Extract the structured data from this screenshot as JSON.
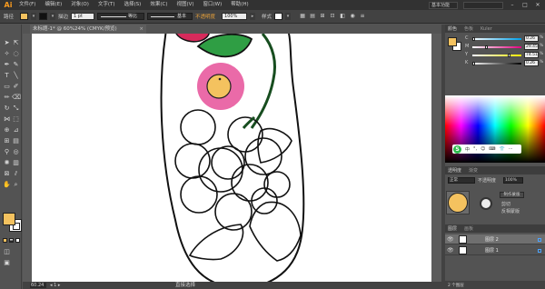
{
  "app": {
    "logo": "Ai"
  },
  "menu": [
    "文件(F)",
    "编辑(E)",
    "对象(O)",
    "文字(T)",
    "选择(S)",
    "效果(C)",
    "视图(V)",
    "窗口(W)",
    "帮助(H)"
  ],
  "workspace": {
    "label": "基本功能"
  },
  "window_controls": [
    "–",
    "□",
    "✕"
  ],
  "control_bar": {
    "object_label": "路径",
    "stroke_label": "描边",
    "stroke_weight": "1 pt",
    "uniform_label": "等比",
    "basic_label": "基本",
    "opacity_label": "不透明度",
    "opacity_value": "100%",
    "style_label": "样式"
  },
  "doc_tab": {
    "title": "未标题-1* @ 60%24% (CMYK/预览)",
    "close": "×"
  },
  "status": {
    "zoom": "60.24",
    "tool_name": "直接选择"
  },
  "color_panel": {
    "tabs": [
      "颜色",
      "色板",
      "Kuler"
    ],
    "rows": [
      {
        "letter": "C",
        "value": "0.26",
        "pct": "%",
        "pos": 0.03,
        "color": "#00a0e9"
      },
      {
        "letter": "M",
        "value": "29.45",
        "pct": "%",
        "pos": 0.29,
        "color": "#e4007f"
      },
      {
        "letter": "Y",
        "value": "74.51",
        "pct": "%",
        "pos": 0.75,
        "color": "#fff100"
      },
      {
        "letter": "K",
        "value": "0.26",
        "pct": "%",
        "pos": 0.03,
        "color": "#000000"
      }
    ]
  },
  "transparency": {
    "tabs": [
      "透明度",
      "渐变"
    ],
    "mode": "正常",
    "opacity_label": "不透明度",
    "opacity_value": "100%",
    "make_mask": "制作蒙版",
    "clip": "剪切",
    "invert": "反相蒙版"
  },
  "layers": {
    "tabs": [
      "图层",
      "画板"
    ],
    "rows": [
      {
        "name": "图层 2",
        "selected": true
      },
      {
        "name": "图层 1",
        "selected": false
      }
    ],
    "count": "2 个图层"
  },
  "ime": {
    "items": [
      "中",
      "°,",
      "☺",
      "⌨",
      "👕",
      "⋯"
    ]
  },
  "colors": {
    "accent_fill": "#f4c25f",
    "pink": "#ea6aa8",
    "leaf": "#2f9e44",
    "stem": "#174d1f",
    "crimson": "#d62a5b"
  }
}
